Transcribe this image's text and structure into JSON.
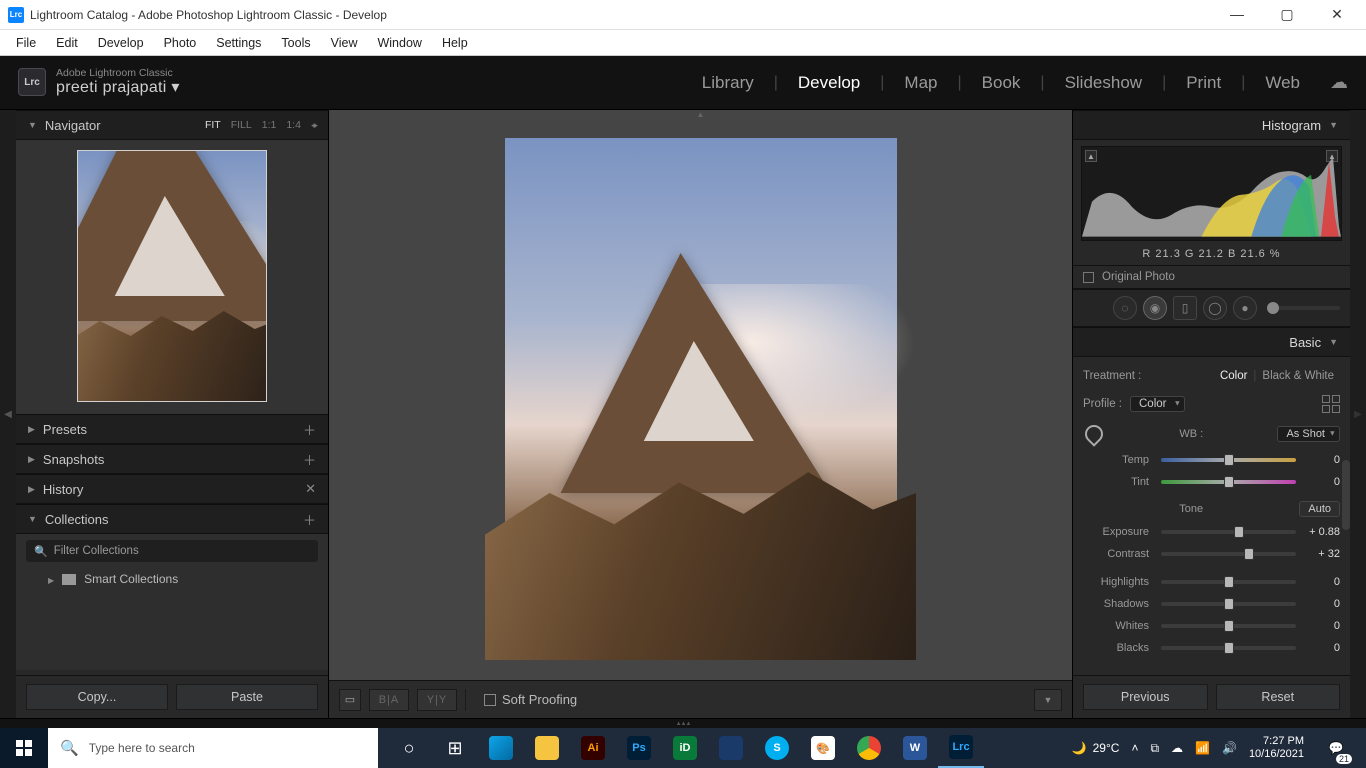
{
  "window": {
    "title": "Lightroom Catalog - Adobe Photoshop Lightroom Classic - Develop",
    "app_icon_text": "Lrc"
  },
  "menubar": [
    "File",
    "Edit",
    "Develop",
    "Photo",
    "Settings",
    "Tools",
    "View",
    "Window",
    "Help"
  ],
  "identity": {
    "brand": "Adobe Lightroom Classic",
    "user": "preeti prajapati",
    "badge": "Lrc"
  },
  "modules": [
    "Library",
    "Develop",
    "Map",
    "Book",
    "Slideshow",
    "Print",
    "Web"
  ],
  "active_module": "Develop",
  "left": {
    "navigator": {
      "title": "Navigator",
      "zoom_levels": [
        "FIT",
        "FILL",
        "1:1",
        "1:4"
      ],
      "zoom_selected": "FIT"
    },
    "presets": "Presets",
    "snapshots": "Snapshots",
    "history": "History",
    "collections": {
      "title": "Collections",
      "filter_placeholder": "Filter Collections",
      "smart": "Smart Collections"
    },
    "copy_btn": "Copy...",
    "paste_btn": "Paste"
  },
  "center": {
    "soft_proofing": "Soft Proofing"
  },
  "right": {
    "histogram": {
      "title": "Histogram",
      "readout": "R   21.3    G   21.2    B   21.6  %",
      "original_photo": "Original Photo"
    },
    "basic": {
      "title": "Basic",
      "treatment_label": "Treatment :",
      "treat_color": "Color",
      "treat_bw": "Black & White",
      "profile_label": "Profile :",
      "profile_value": "Color",
      "wb_label": "WB :",
      "wb_value": "As Shot",
      "tone_label": "Tone",
      "auto": "Auto",
      "sliders": {
        "temp": {
          "label": "Temp",
          "value": "0",
          "pos": 50
        },
        "tint": {
          "label": "Tint",
          "value": "0",
          "pos": 50
        },
        "exposure": {
          "label": "Exposure",
          "value": "+ 0.88",
          "pos": 58
        },
        "contrast": {
          "label": "Contrast",
          "value": "+ 32",
          "pos": 65
        },
        "highlights": {
          "label": "Highlights",
          "value": "0",
          "pos": 50
        },
        "shadows": {
          "label": "Shadows",
          "value": "0",
          "pos": 50
        },
        "whites": {
          "label": "Whites",
          "value": "0",
          "pos": 50
        },
        "blacks": {
          "label": "Blacks",
          "value": "0",
          "pos": 50
        }
      }
    },
    "previous": "Previous",
    "reset": "Reset"
  },
  "taskbar": {
    "search_placeholder": "Type here to search",
    "weather": "29°C",
    "time": "7:27 PM",
    "date": "10/16/2021",
    "notif_count": "21"
  }
}
